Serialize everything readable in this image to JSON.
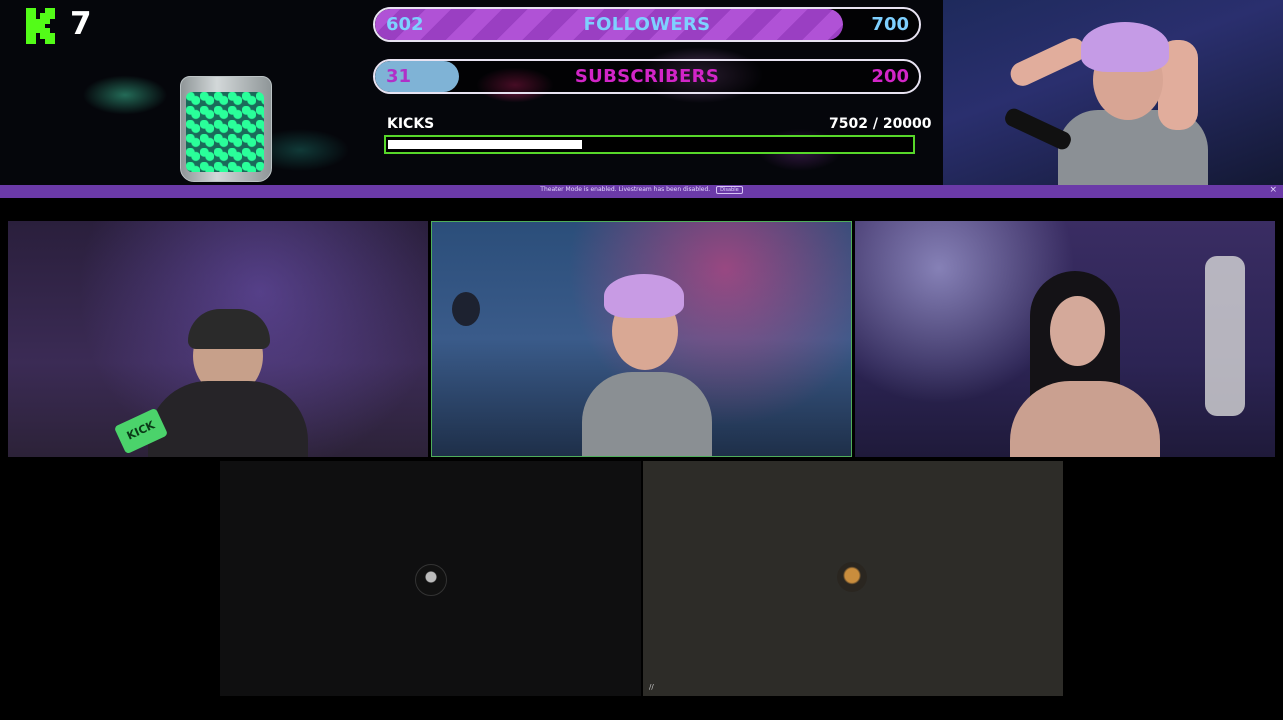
{
  "overlay": {
    "kick_count": "7",
    "followers": {
      "current": "602",
      "title": "FOLLOWERS",
      "goal": "700",
      "progress": 0.86
    },
    "subscribers": {
      "current": "31",
      "title": "SUBSCRIBERS",
      "goal": "200",
      "progress": 0.155
    },
    "kicks": {
      "label": "KICKS",
      "count_text": "7502  / 20000",
      "progress": 0.375
    }
  },
  "banner": {
    "text": "Theater Mode is enabled. Livestream has been disabled.",
    "button_label": "Disable",
    "close_label": "×"
  },
  "tiles": [
    {
      "name": "participant-1",
      "sign_text": "KICK"
    },
    {
      "name": "participant-2"
    },
    {
      "name": "participant-3"
    },
    {
      "name": "participant-4"
    },
    {
      "name": "participant-5",
      "badge": "//"
    }
  ],
  "colors": {
    "kick_green": "#53fc18",
    "banner_purple": "#6b3aa8",
    "active_tile_border": "#4fae5b"
  },
  "icons": [
    "kick-logo-icon",
    "close-icon"
  ]
}
